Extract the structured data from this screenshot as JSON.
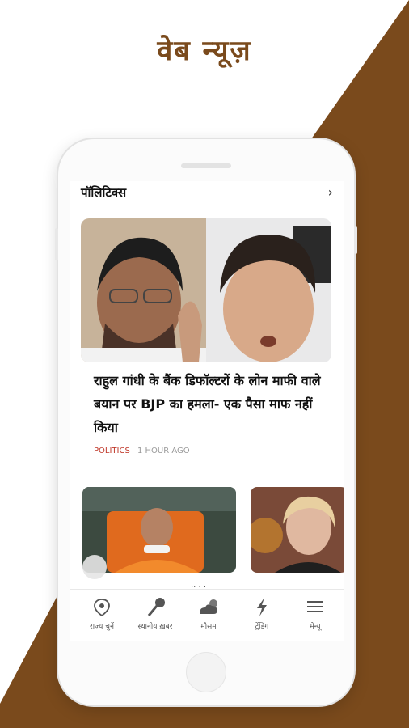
{
  "promo": {
    "title": "वेब न्यूज़"
  },
  "section": {
    "title": "पॉलिटिक्स",
    "more_icon": "chevron-right-icon"
  },
  "hero": {
    "headline": "राहुल गांधी के बैंक डिफॉल्टरों के लोन माफी वाले बयान पर BJP का हमला- एक पैसा माफ नहीं किया",
    "category": "POLITICS",
    "time": "1 HOUR AGO"
  },
  "bottom_nav": {
    "items": [
      {
        "label": "राज्य चुनें",
        "icon": "location-pin-icon"
      },
      {
        "label": "स्थानीय ख़बर",
        "icon": "microphone-icon"
      },
      {
        "label": "मौसम",
        "icon": "weather-icon"
      },
      {
        "label": "ट्रेंडिंग",
        "icon": "lightning-icon"
      },
      {
        "label": "मेन्यू",
        "icon": "menu-icon"
      }
    ]
  },
  "colors": {
    "brand_brown": "#7a4a1c",
    "category_red": "#c0392b"
  }
}
